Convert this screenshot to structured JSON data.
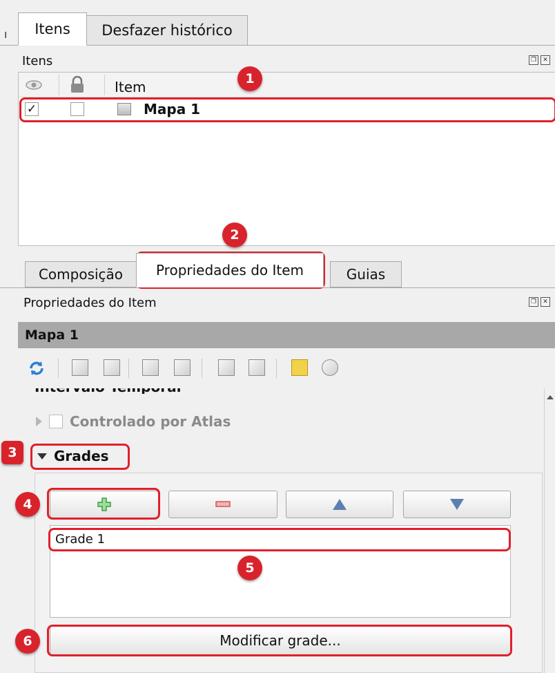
{
  "top_tabs": [
    {
      "label": "Itens",
      "active": true
    },
    {
      "label": "Desfazer histórico",
      "active": false
    }
  ],
  "items_panel": {
    "title": "Itens",
    "columns": {
      "visible": "eye-icon",
      "locked": "lock-icon",
      "item": "Item"
    },
    "rows": [
      {
        "visible": true,
        "visible_mark": "✓",
        "locked": false,
        "name": "Mapa 1"
      }
    ]
  },
  "prop_tabs": [
    {
      "label": "Composição",
      "active": false
    },
    {
      "label": "Propriedades do Item",
      "active": true
    },
    {
      "label": "Guias",
      "active": false
    }
  ],
  "properties_panel": {
    "title": "Propriedades do Item",
    "item_name": "Mapa 1",
    "sections": {
      "temporal_partial": "Intervalo Temporal",
      "atlas": "Controlado por Atlas",
      "grids": "Grades"
    },
    "grid_buttons": {
      "add": "+",
      "remove": "−",
      "up": "▲",
      "down": "▼"
    },
    "grid_list": [
      "Grade 1"
    ],
    "modify_button": "Modificar grade..."
  },
  "annotations": [
    "1",
    "2",
    "3",
    "4",
    "5",
    "6"
  ],
  "colors": {
    "annotation_red": "#d9232c",
    "title_bar": "#a8a8a8",
    "add_green": "#3aa03a",
    "remove_red": "#e07a7a",
    "arrow_blue": "#5b7fb0"
  }
}
